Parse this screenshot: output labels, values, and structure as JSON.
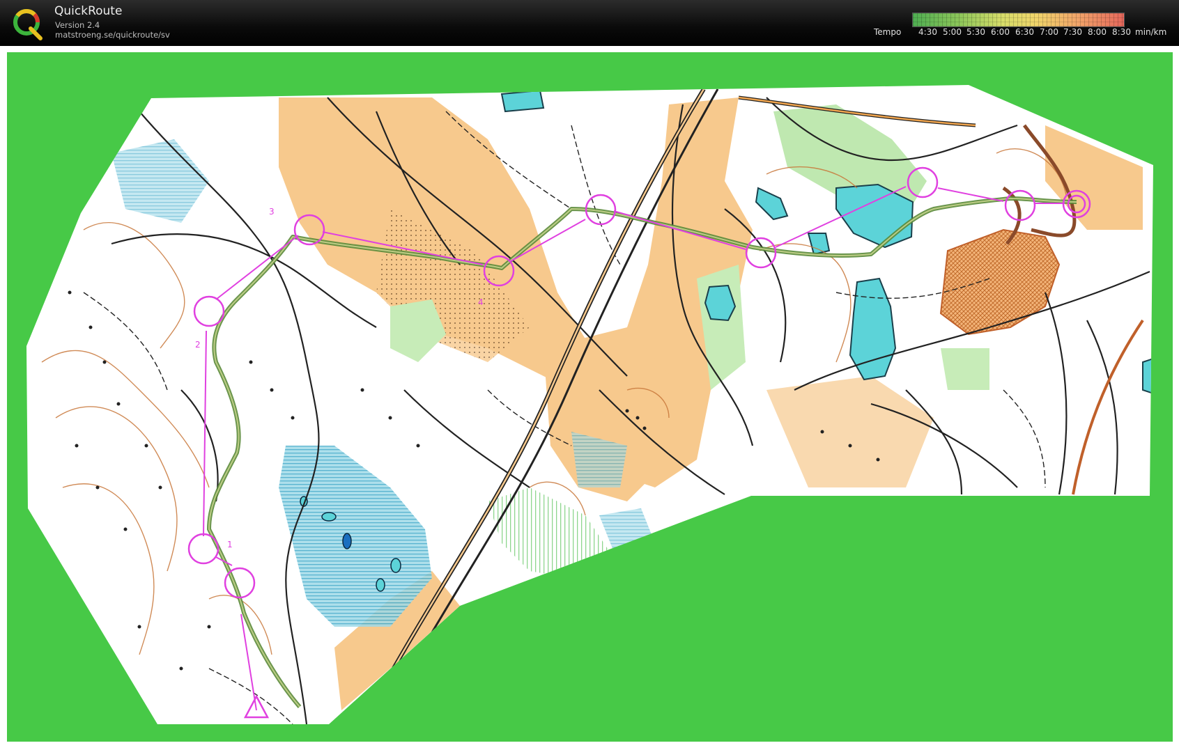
{
  "app": {
    "name": "QuickRoute",
    "version": "Version 2.4",
    "url": "matstroeng.se/quickroute/sv"
  },
  "legend": {
    "label": "Tempo",
    "ticks": [
      "4:30",
      "5:00",
      "5:30",
      "6:00",
      "6:30",
      "7:00",
      "7:30",
      "8:00",
      "8:30"
    ],
    "unit": "min/km",
    "colors": [
      "#4fae52",
      "#8dc65a",
      "#d6dd6a",
      "#f0d66b",
      "#f1a56a",
      "#e6675b"
    ]
  },
  "map": {
    "background_color": "#47c947",
    "course_color": "#e040e0",
    "route_color": "#5a8a3a",
    "control_labels": [
      "1",
      "2",
      "3",
      "4"
    ]
  }
}
